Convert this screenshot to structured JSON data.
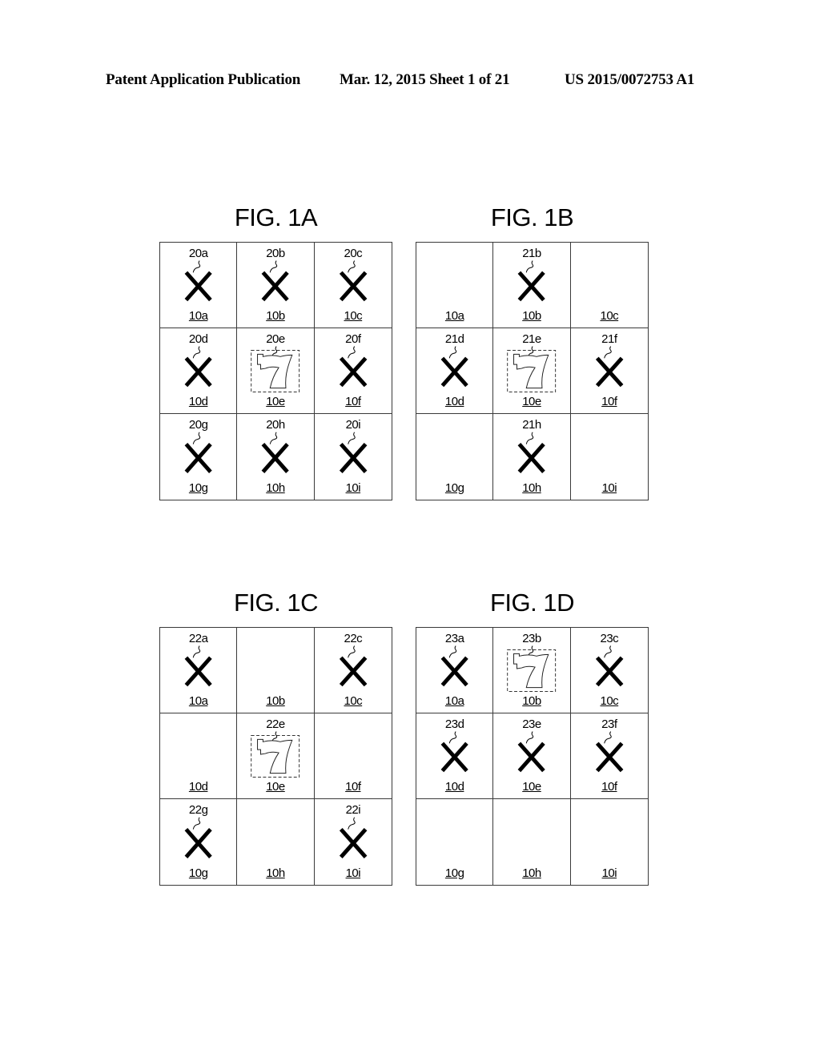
{
  "header": {
    "left": "Patent Application Publication",
    "middle": "Mar. 12, 2015  Sheet 1 of 21",
    "right": "US 2015/0072753 A1"
  },
  "figures": [
    {
      "title": "FIG. 1A",
      "cells": [
        {
          "position": "10a",
          "ref": "20a",
          "symbol": "x"
        },
        {
          "position": "10b",
          "ref": "20b",
          "symbol": "x"
        },
        {
          "position": "10c",
          "ref": "20c",
          "symbol": "x"
        },
        {
          "position": "10d",
          "ref": "20d",
          "symbol": "x"
        },
        {
          "position": "10e",
          "ref": "20e",
          "symbol": "seven"
        },
        {
          "position": "10f",
          "ref": "20f",
          "symbol": "x"
        },
        {
          "position": "10g",
          "ref": "20g",
          "symbol": "x"
        },
        {
          "position": "10h",
          "ref": "20h",
          "symbol": "x"
        },
        {
          "position": "10i",
          "ref": "20i",
          "symbol": "x"
        }
      ]
    },
    {
      "title": "FIG. 1B",
      "cells": [
        {
          "position": "10a",
          "ref": "",
          "symbol": "none"
        },
        {
          "position": "10b",
          "ref": "21b",
          "symbol": "x"
        },
        {
          "position": "10c",
          "ref": "",
          "symbol": "none"
        },
        {
          "position": "10d",
          "ref": "21d",
          "symbol": "x"
        },
        {
          "position": "10e",
          "ref": "21e",
          "symbol": "seven"
        },
        {
          "position": "10f",
          "ref": "21f",
          "symbol": "x"
        },
        {
          "position": "10g",
          "ref": "",
          "symbol": "none"
        },
        {
          "position": "10h",
          "ref": "21h",
          "symbol": "x"
        },
        {
          "position": "10i",
          "ref": "",
          "symbol": "none"
        }
      ]
    },
    {
      "title": "FIG. 1C",
      "cells": [
        {
          "position": "10a",
          "ref": "22a",
          "symbol": "x"
        },
        {
          "position": "10b",
          "ref": "",
          "symbol": "none"
        },
        {
          "position": "10c",
          "ref": "22c",
          "symbol": "x"
        },
        {
          "position": "10d",
          "ref": "",
          "symbol": "none"
        },
        {
          "position": "10e",
          "ref": "22e",
          "symbol": "seven"
        },
        {
          "position": "10f",
          "ref": "",
          "symbol": "none"
        },
        {
          "position": "10g",
          "ref": "22g",
          "symbol": "x"
        },
        {
          "position": "10h",
          "ref": "",
          "symbol": "none"
        },
        {
          "position": "10i",
          "ref": "22i",
          "symbol": "x"
        }
      ]
    },
    {
      "title": "FIG. 1D",
      "cells": [
        {
          "position": "10a",
          "ref": "23a",
          "symbol": "x"
        },
        {
          "position": "10b",
          "ref": "23b",
          "symbol": "seven"
        },
        {
          "position": "10c",
          "ref": "23c",
          "symbol": "x"
        },
        {
          "position": "10d",
          "ref": "23d",
          "symbol": "x"
        },
        {
          "position": "10e",
          "ref": "23e",
          "symbol": "x"
        },
        {
          "position": "10f",
          "ref": "23f",
          "symbol": "x"
        },
        {
          "position": "10g",
          "ref": "",
          "symbol": "none"
        },
        {
          "position": "10h",
          "ref": "",
          "symbol": "none"
        },
        {
          "position": "10i",
          "ref": "",
          "symbol": "none"
        }
      ]
    }
  ]
}
